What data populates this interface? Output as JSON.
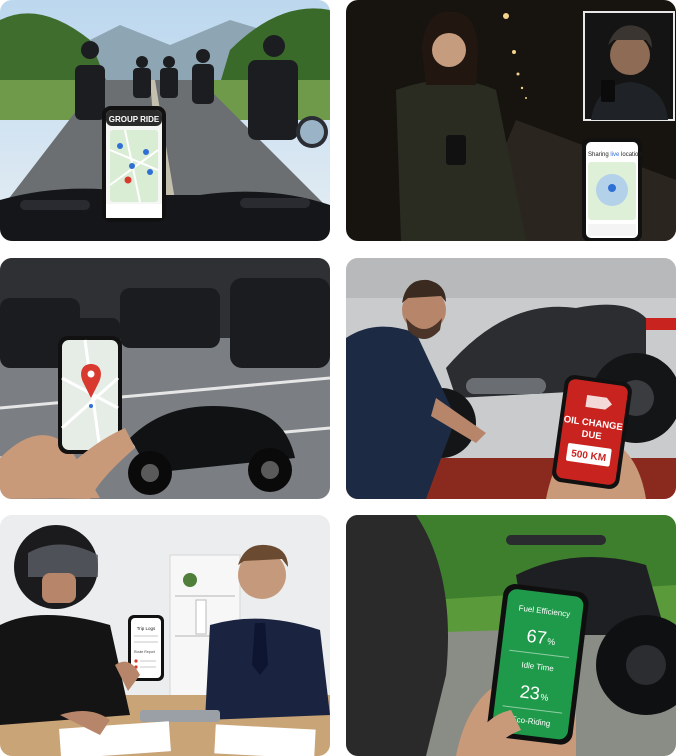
{
  "tiles": [
    {
      "id": "group-ride",
      "phone_title": "GROUP RIDE"
    },
    {
      "id": "share-location",
      "phone_title_a": "Sharing ",
      "phone_title_b": "live",
      "phone_title_c": " location"
    },
    {
      "id": "find-parked-bike"
    },
    {
      "id": "maintenance",
      "alert_title_line1": "OIL CHANGE",
      "alert_title_line2": "DUE",
      "alert_value": "500 KM"
    },
    {
      "id": "trip-logs",
      "phone_title": "Trip Logs",
      "phone_item": "Route Report"
    },
    {
      "id": "eco-riding",
      "metric1_label": "Fuel Efficiency",
      "metric1_value": "67",
      "metric1_unit": "%",
      "metric2_label": "Idle Time",
      "metric2_value": "23",
      "metric2_unit": "%",
      "footer_label": "Eco-Riding"
    }
  ],
  "colors": {
    "map_green": "#cfe6c6",
    "pin_red": "#d93a30",
    "pin_blue": "#2f6fd6",
    "alert_red": "#c9231f",
    "eco_green": "#1f9a4a"
  }
}
